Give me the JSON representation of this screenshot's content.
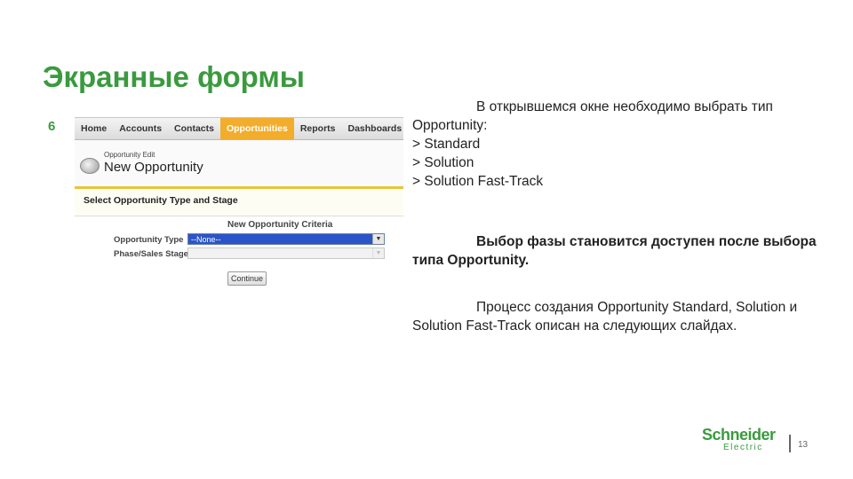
{
  "slide": {
    "title": "Экранные формы",
    "step_number": "6"
  },
  "screenshot": {
    "tabs": [
      {
        "label": "Home",
        "active": false
      },
      {
        "label": "Accounts",
        "active": false
      },
      {
        "label": "Contacts",
        "active": false
      },
      {
        "label": "Opportunities",
        "active": true
      },
      {
        "label": "Reports",
        "active": false
      },
      {
        "label": "Dashboards",
        "active": false
      },
      {
        "label": "S",
        "active": false
      }
    ],
    "breadcrumb": "Opportunity Edit",
    "page_title": "New Opportunity",
    "section_title": "Select Opportunity Type and Stage",
    "criteria_heading": "New Opportunity Criteria",
    "opportunity_type_label": "Opportunity Type",
    "opportunity_type_value": "--None--",
    "phase_stage_label": "Phase/Sales Stage",
    "phase_stage_value": "",
    "continue_label": "Continue",
    "accent_color": "#f2ad2c"
  },
  "text": {
    "p1_intro": "В открывшемся окне необходимо выбрать тип Opportunity:",
    "options": [
      "> Standard",
      "> Solution",
      "> Solution Fast-Track"
    ],
    "p2": "Выбор фазы становится доступен после выбора типа Opportunity.",
    "p3": "Процесс создания Opportunity Standard, Solution и Solution Fast-Track описан на следующих слайдах."
  },
  "footer": {
    "logo_line1": "Schneider",
    "logo_line2": "Electric",
    "page_number": "13",
    "brand_color": "#3a9a3e"
  }
}
